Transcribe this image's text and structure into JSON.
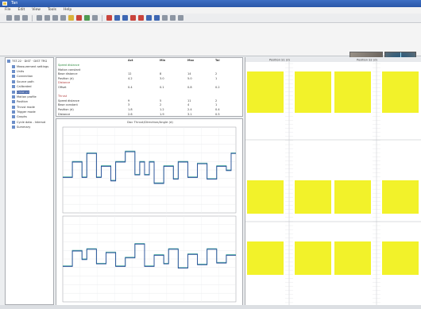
{
  "window": {
    "title": "Tan"
  },
  "menu": [
    "File",
    "Edit",
    "View",
    "Tools",
    "Help"
  ],
  "toolbar": [
    "grey",
    "grey",
    "grey",
    "sep",
    "grey",
    "grey",
    "grey",
    "grey",
    "yellow",
    "red",
    "green",
    "grey",
    "sep",
    "red",
    "blue",
    "blue",
    "red",
    "red",
    "blue",
    "blue",
    "grey",
    "grey",
    "grey"
  ],
  "chart": {
    "title": "Doc Thrust/Direction/Angle (d)"
  },
  "colors": {
    "highlight": "#f2f22a",
    "trace_a": "#4aa9a0",
    "trace_b": "#2b4f9b",
    "selection": "#2b4f9b"
  },
  "tree": [
    {
      "label": "TST-22 · DIST · DIST TRG",
      "icon": "folder-icon"
    },
    {
      "label": "Measurement settings",
      "icon": "gear-icon"
    },
    {
      "label": "Units",
      "icon": "doc-icon"
    },
    {
      "label": "Connection",
      "icon": "doc-icon"
    },
    {
      "label": "Source path",
      "icon": "doc-icon"
    },
    {
      "label": "Calibrated",
      "icon": "doc-icon"
    },
    {
      "label": "Distance",
      "icon": "doc-icon",
      "selected": true
    },
    {
      "label": "Motion profile",
      "icon": "doc-icon"
    },
    {
      "label": "Position",
      "icon": "doc-icon"
    },
    {
      "label": "Thrust mode",
      "icon": "doc-icon"
    },
    {
      "label": "Trigger mode",
      "icon": "doc-icon"
    },
    {
      "label": "Graphs",
      "icon": "chart-icon"
    },
    {
      "label": "Cycle data - Interval",
      "icon": "chart-icon"
    },
    {
      "label": "Summary",
      "icon": "doc-icon"
    }
  ],
  "grid": {
    "header": [
      "",
      "Act",
      "Min",
      "Max",
      "Tol"
    ],
    "rows": [
      {
        "cells": [
          "Speed distance",
          "",
          "",
          "",
          ""
        ],
        "color": "#2b8a3e"
      },
      {
        "cells": [
          "Motion constant",
          "",
          "",
          "",
          ""
        ],
        "color": "#333"
      },
      {
        "cells": [
          "Base distance",
          "12",
          "8",
          "14",
          "2"
        ],
        "color": "#333"
      },
      {
        "cells": [
          "Position (d)",
          "4.2",
          "3.0",
          "5.0",
          "1"
        ],
        "color": "#333"
      },
      {
        "cells": [
          "Distance",
          "",
          "",
          "",
          ""
        ],
        "color": "#b03a3a"
      },
      {
        "cells": [
          "Offset",
          "0.4",
          "0.1",
          "0.8",
          "0.2"
        ],
        "color": "#333"
      },
      {
        "cells": [
          "",
          "",
          "",
          "",
          ""
        ],
        "color": "#333"
      },
      {
        "cells": [
          "Thrust",
          "",
          "",
          "",
          ""
        ],
        "color": "#b03a3a"
      },
      {
        "cells": [
          "Speed distance",
          "9",
          "5",
          "11",
          "2"
        ],
        "color": "#333"
      },
      {
        "cells": [
          "Base constant",
          "3",
          "2",
          "4",
          "1"
        ],
        "color": "#333"
      },
      {
        "cells": [
          "Position (d)",
          "1.8",
          "1.2",
          "2.4",
          "0.4"
        ],
        "color": "#333"
      },
      {
        "cells": [
          "Distance",
          "2.6",
          "1.9",
          "3.1",
          "0.5"
        ],
        "color": "#333"
      }
    ]
  },
  "rightpanel": {
    "headers": [
      "Position S1 (d)",
      "Position S2 (d)"
    ]
  }
}
